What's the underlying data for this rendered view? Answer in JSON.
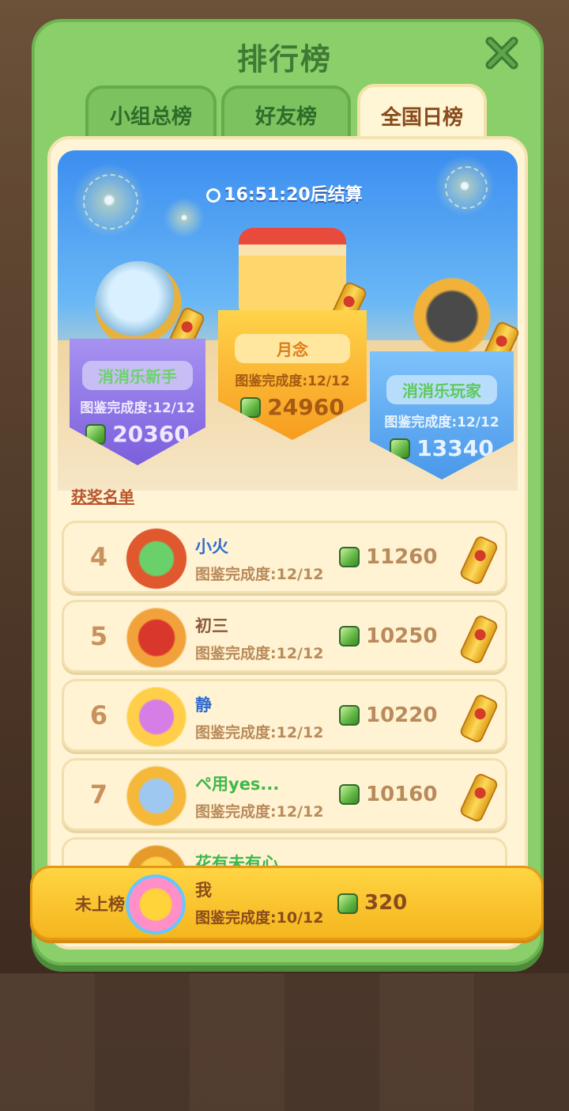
{
  "header": {
    "title": "排行榜",
    "close_icon": "close-x-icon"
  },
  "tabs": [
    {
      "label": "小组总榜",
      "active": false
    },
    {
      "label": "好友榜",
      "active": false
    },
    {
      "label": "全国日榜",
      "active": true
    }
  ],
  "timer": {
    "text": "16:51:20后结算",
    "icon": "clock-icon"
  },
  "podium": {
    "first": {
      "name": "月念",
      "progress": "图鉴完成度:12/12",
      "score": "24960"
    },
    "second": {
      "name": "消消乐新手",
      "progress": "图鉴完成度:12/12",
      "score": "20360"
    },
    "third": {
      "name": "消消乐玩家",
      "progress": "图鉴完成度:12/12",
      "score": "13340"
    }
  },
  "awards_title": "获奖名单",
  "rows": [
    {
      "rank": "4",
      "name": "小火",
      "progress": "图鉴完成度:12/12",
      "score": "11260"
    },
    {
      "rank": "5",
      "name": "初三",
      "progress": "图鉴完成度:12/12",
      "score": "10250"
    },
    {
      "rank": "6",
      "name": "静",
      "progress": "图鉴完成度:12/12",
      "score": "10220"
    },
    {
      "rank": "7",
      "name": "ペ用yes...",
      "progress": "图鉴完成度:12/12",
      "score": "10160"
    },
    {
      "rank": "",
      "name": "花有未有心",
      "progress": "",
      "score": ""
    }
  ],
  "me": {
    "label": "未上榜",
    "name": "我",
    "progress": "图鉴完成度:10/12",
    "score": "320"
  },
  "colors": {
    "panel": "#8bcf6a",
    "accent_orange": "#f5b61d",
    "purple": "#8c72e6",
    "blue": "#5aa8f2"
  }
}
